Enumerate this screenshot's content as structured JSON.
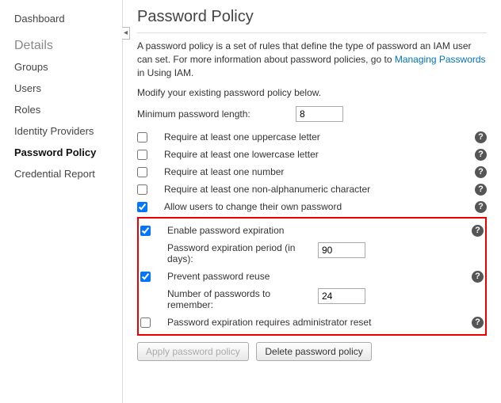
{
  "sidebar": {
    "dashboard": "Dashboard",
    "header": "Details",
    "items": [
      {
        "label": "Groups"
      },
      {
        "label": "Users"
      },
      {
        "label": "Roles"
      },
      {
        "label": "Identity Providers"
      },
      {
        "label": "Password Policy"
      },
      {
        "label": "Credential Report"
      }
    ]
  },
  "page": {
    "title": "Password Policy",
    "intro_pre": "A password policy is a set of rules that define the type of password an IAM user can set. For more information about password policies, go to ",
    "intro_link": "Managing Passwords",
    "intro_post": " in Using IAM.",
    "modify": "Modify your existing password policy below.",
    "min_length_label": "Minimum password length:",
    "min_length_value": "8"
  },
  "options": {
    "uppercase": {
      "label": "Require at least one uppercase letter",
      "checked": false
    },
    "lowercase": {
      "label": "Require at least one lowercase letter",
      "checked": false
    },
    "number": {
      "label": "Require at least one number",
      "checked": false
    },
    "nonalpha": {
      "label": "Require at least one non-alphanumeric character",
      "checked": false
    },
    "allow_change": {
      "label": "Allow users to change their own password",
      "checked": true
    },
    "expiration": {
      "label": "Enable password expiration",
      "checked": true,
      "period_label": "Password expiration period (in days):",
      "period_value": "90"
    },
    "reuse": {
      "label": "Prevent password reuse",
      "checked": true,
      "remember_label": "Number of passwords to remember:",
      "remember_value": "24"
    },
    "admin_reset": {
      "label": "Password expiration requires administrator reset",
      "checked": false
    }
  },
  "buttons": {
    "apply": "Apply password policy",
    "delete": "Delete password policy"
  },
  "icons": {
    "help": "?",
    "collapse": "◂"
  }
}
